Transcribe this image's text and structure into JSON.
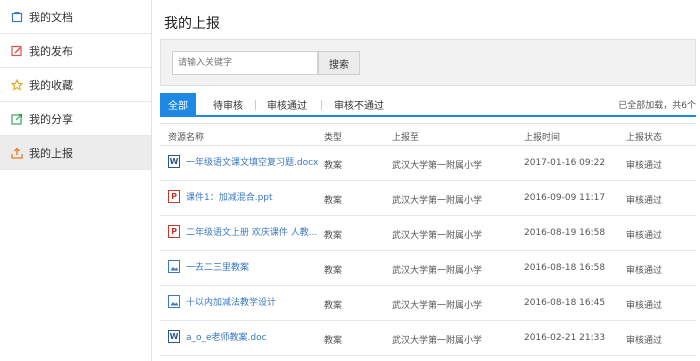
{
  "sidebar": {
    "items": [
      {
        "label": "我的文档",
        "icon": "document-icon"
      },
      {
        "label": "我的发布",
        "icon": "edit-icon"
      },
      {
        "label": "我的收藏",
        "icon": "star-icon"
      },
      {
        "label": "我的分享",
        "icon": "share-icon"
      },
      {
        "label": "我的上报",
        "icon": "upload-icon"
      }
    ]
  },
  "page": {
    "title": "我的上报"
  },
  "search": {
    "placeholder": "请输入关键字",
    "button": "搜索"
  },
  "tabs": {
    "all": "全部",
    "pending": "待审核",
    "approved": "审核通过",
    "rejected": "审核不通过",
    "loaded_info": "已全部加载，共6个"
  },
  "table": {
    "headers": {
      "name": "资源名称",
      "type": "类型",
      "target": "上报至",
      "time": "上报时间",
      "status": "上报状态"
    },
    "rows": [
      {
        "name": "一年级语文课文填空复习题.docx",
        "file_icon": "word-file-icon",
        "type": "教案",
        "target": "武汉大学第一附属小学",
        "time": "2017-01-16 09:22",
        "status": "审核通过"
      },
      {
        "name": "课件1：加减混合.ppt",
        "file_icon": "ppt-file-icon",
        "type": "教案",
        "target": "武汉大学第一附属小学",
        "time": "2016-09-09 11:17",
        "status": "审核通过"
      },
      {
        "name": "二年级语文上册 欢庆课件 人教...",
        "file_icon": "ppt-file-icon",
        "type": "教案",
        "target": "武汉大学第一附属小学",
        "time": "2016-08-19 16:58",
        "status": "审核通过"
      },
      {
        "name": "一去二三里教案",
        "file_icon": "image-file-icon",
        "type": "教案",
        "target": "武汉大学第一附属小学",
        "time": "2016-08-18 16:58",
        "status": "审核通过"
      },
      {
        "name": "十以内加减法教学设计",
        "file_icon": "image-file-icon",
        "type": "教案",
        "target": "武汉大学第一附属小学",
        "time": "2016-08-18 16:45",
        "status": "审核通过"
      },
      {
        "name": "a_o_e老师教案.doc",
        "file_icon": "word-file-icon",
        "type": "教案",
        "target": "武汉大学第一附属小学",
        "time": "2016-02-21 21:33",
        "status": "审核通过"
      }
    ]
  },
  "colors": {
    "accent": "#1e88e5",
    "link": "#3a78c3"
  }
}
